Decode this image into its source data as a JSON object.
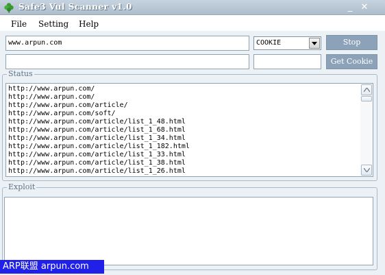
{
  "window": {
    "title": "Safe3 Vul Scanner v1.0",
    "minimize_glyph": "_",
    "close_glyph": "✕",
    "icon": "clover-icon"
  },
  "menu": {
    "items": [
      "File",
      "Setting",
      "Help"
    ]
  },
  "form": {
    "url_value": "www.arpun.com",
    "second_value": "",
    "method_select": "COOKIE",
    "extra_value": "",
    "stop_label": "Stop",
    "get_cookie_label": "Get Cookie"
  },
  "status": {
    "label": "Status",
    "lines": [
      "http://www.arpun.com/",
      "http://www.arpun.com/",
      "http://www.arpun.com/article/",
      "http://www.arpun.com/soft/",
      "http://www.arpun.com/article/list_1_48.html",
      "http://www.arpun.com/article/list_1_68.html",
      "http://www.arpun.com/article/list_1_34.html",
      "http://www.arpun.com/article/list_1_182.html",
      "http://www.arpun.com/article/list_1_33.html",
      "http://www.arpun.com/article/list_1_38.html",
      "http://www.arpun.com/article/list_1_26.html"
    ]
  },
  "exploit": {
    "label": "Exploit",
    "content": ""
  },
  "watermark": {
    "text": "ARP联盟 arpun.com"
  },
  "colors": {
    "titlebar": "#b7c6d5",
    "button": "#8ca2b8",
    "panel": "#ecf1f6",
    "watermark": "#2020e8"
  }
}
